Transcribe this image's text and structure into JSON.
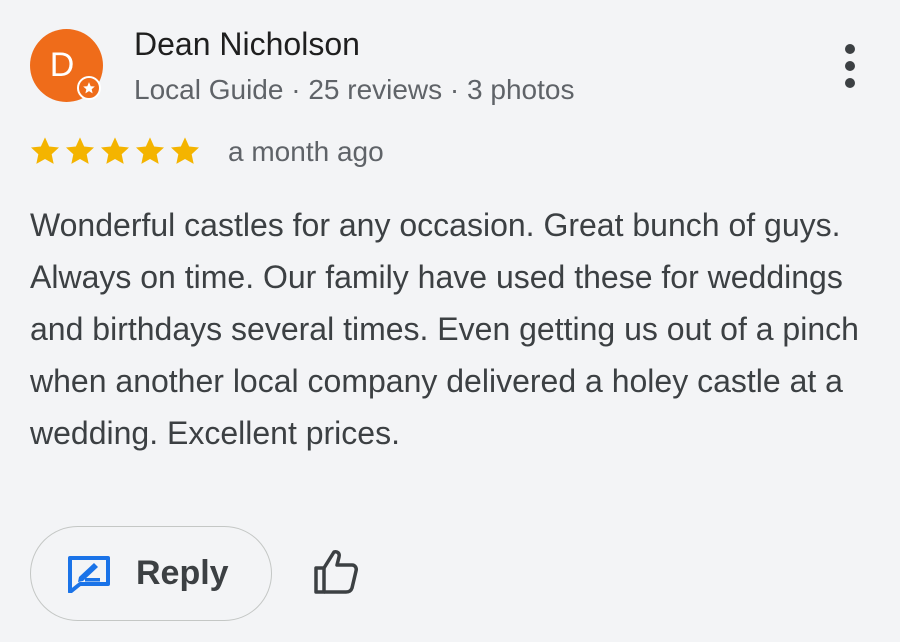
{
  "review": {
    "avatar_letter": "D",
    "avatar_color": "#ef6c1a",
    "reviewer_name": "Dean Nicholson",
    "reviewer_meta": "Local Guide · 25 reviews · 3 photos",
    "rating": 5,
    "rating_max": 5,
    "star_color": "#f4b400",
    "time_ago": "a month ago",
    "text": "Wonderful castles for any occasion. Great bunch of guys. Always on time. Our family have used these for weddings and birthdays several times. Even getting us out of a pinch when another local company delivered a holey castle at a wedding. Excellent prices."
  },
  "actions": {
    "reply_label": "Reply",
    "reply_icon": "reply-edit-icon",
    "like_icon": "thumbs-up-icon",
    "more_icon": "more-vert-icon",
    "reply_icon_color": "#1a73e8"
  }
}
